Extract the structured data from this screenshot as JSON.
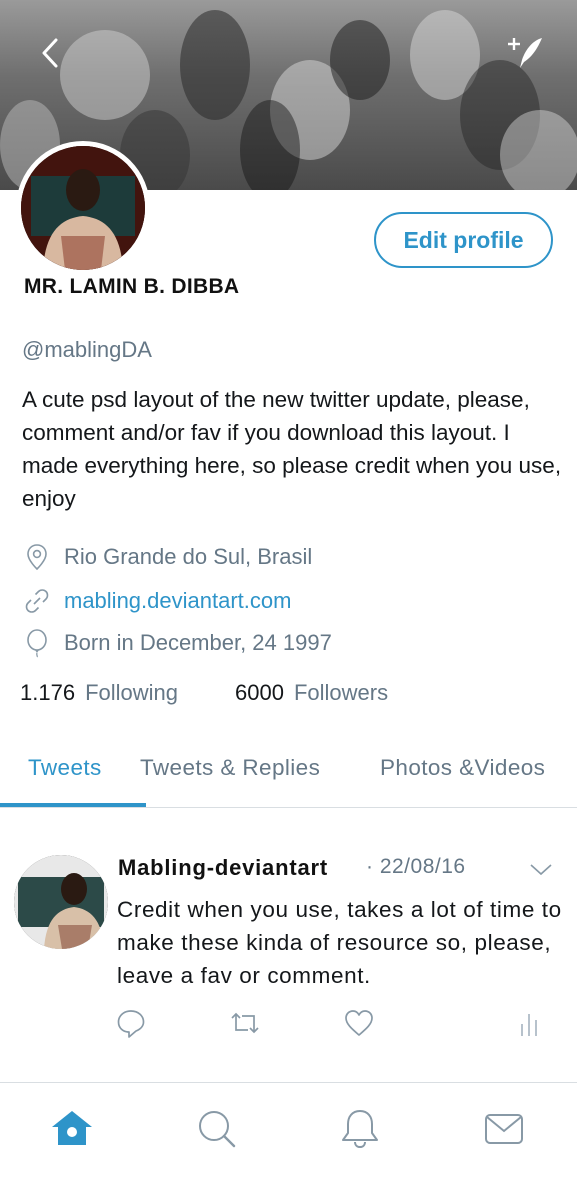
{
  "header": {
    "back_icon": "chevron-left-icon",
    "compose_icon": "compose-tweet-icon"
  },
  "profile": {
    "display_name": "MR. LAMIN B. DIBBA",
    "handle": "@mablingDA",
    "bio": "A cute psd layout of the new twitter update, please, comment and/or fav if you download this layout. I made everything here, so please credit when you use, enjoy",
    "location": "Rio Grande do Sul, Brasil",
    "website": "mabling.deviantart.com",
    "birthday": "Born in December, 24 1997",
    "edit_label": "Edit profile"
  },
  "stats": {
    "following_count": "1.176",
    "following_label": "Following",
    "followers_count": "6000",
    "followers_label": "Followers"
  },
  "tabs": [
    {
      "label": "Tweets",
      "active": true
    },
    {
      "label": "Tweets & Replies",
      "active": false
    },
    {
      "label": "Photos &Videos",
      "active": false
    }
  ],
  "tweet": {
    "author": "Mabling-deviantart",
    "date": "· 22/08/16",
    "text": "Credit when you use, takes a lot of time to make these kinda of resource so, please, leave a fav or comment.",
    "actions": [
      "reply-icon",
      "retweet-icon",
      "like-icon",
      "analytics-icon"
    ]
  },
  "bottom_nav": [
    "home-icon",
    "search-icon",
    "notifications-icon",
    "messages-icon"
  ],
  "colors": {
    "accent": "#2e94c9",
    "muted": "#657786",
    "text": "#14171a",
    "divider": "#d9dee2"
  }
}
